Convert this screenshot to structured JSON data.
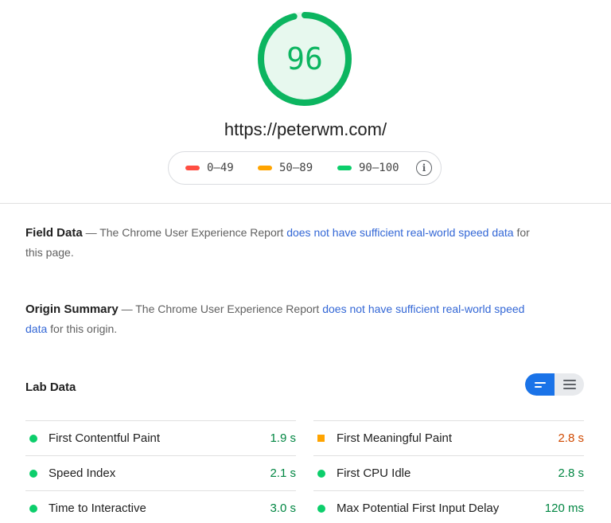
{
  "score": {
    "value": "96",
    "fraction": 0.96,
    "color": "#0cb560",
    "fill": "#e7f8ee"
  },
  "url": "https://peterwm.com/",
  "legend": {
    "items": [
      {
        "label": "0–49",
        "color": "#ff4e42"
      },
      {
        "label": "50–89",
        "color": "#ffa400"
      },
      {
        "label": "90–100",
        "color": "#0cce6b"
      }
    ],
    "info_icon": "info-icon"
  },
  "field_data": {
    "title": "Field Data",
    "text_before": " — The Chrome User Experience Report ",
    "link": "does not have sufficient real-world speed data",
    "text_after": " for this page."
  },
  "origin_summary": {
    "title": "Origin Summary",
    "text_before": " — The Chrome User Experience Report ",
    "link": "does not have sufficient real-world speed data",
    "text_after": " for this origin."
  },
  "lab_data": {
    "title": "Lab Data",
    "toggle": {
      "left_icon": "collapsed-view-icon",
      "right_icon": "expanded-view-icon",
      "active": "left"
    },
    "left_metrics": [
      {
        "name": "First Contentful Paint",
        "value": "1.9 s",
        "status": "pass",
        "color": "#0cce6b",
        "value_color": "#018642"
      },
      {
        "name": "Speed Index",
        "value": "2.1 s",
        "status": "pass",
        "color": "#0cce6b",
        "value_color": "#018642"
      },
      {
        "name": "Time to Interactive",
        "value": "3.0 s",
        "status": "pass",
        "color": "#0cce6b",
        "value_color": "#018642"
      }
    ],
    "right_metrics": [
      {
        "name": "First Meaningful Paint",
        "value": "2.8 s",
        "status": "average",
        "color": "#ffa400",
        "value_color": "#d04900"
      },
      {
        "name": "First CPU Idle",
        "value": "2.8 s",
        "status": "pass",
        "color": "#0cce6b",
        "value_color": "#018642"
      },
      {
        "name": "Max Potential First Input Delay",
        "value": "120 ms",
        "status": "pass",
        "color": "#0cce6b",
        "value_color": "#018642"
      }
    ]
  }
}
